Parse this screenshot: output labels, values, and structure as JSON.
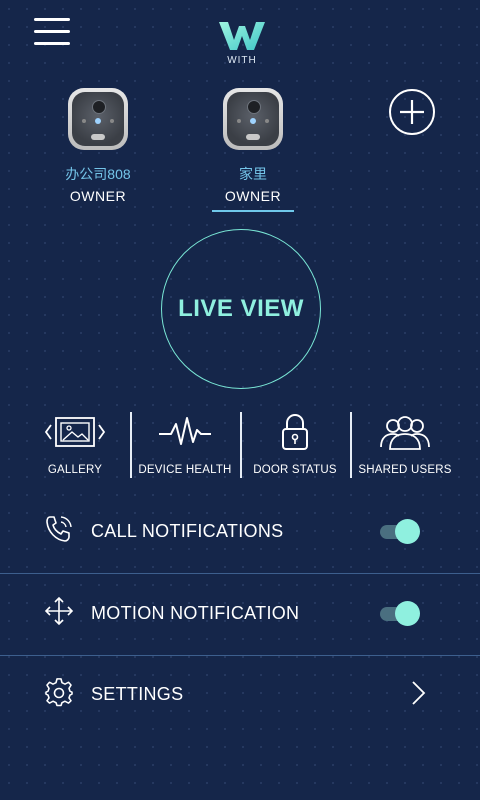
{
  "app": {
    "logo_text": "WITH"
  },
  "devices": [
    {
      "name": "办公司808",
      "role": "OWNER",
      "selected": false
    },
    {
      "name": "家里",
      "role": "OWNER",
      "selected": true
    }
  ],
  "live_view": {
    "label": "LIVE VIEW"
  },
  "features": [
    {
      "label": "GALLERY",
      "icon": "gallery-icon"
    },
    {
      "label": "DEVICE HEALTH",
      "icon": "heartbeat-icon"
    },
    {
      "label": "DOOR STATUS",
      "icon": "lock-icon"
    },
    {
      "label": "SHARED USERS",
      "icon": "users-icon"
    }
  ],
  "settings": {
    "call_notifications": {
      "label": "CALL NOTIFICATIONS",
      "enabled": true,
      "icon": "phone-ringing-icon"
    },
    "motion_notification": {
      "label": "MOTION NOTIFICATION",
      "enabled": true,
      "icon": "move-arrows-icon"
    },
    "settings": {
      "label": "SETTINGS",
      "icon": "gear-icon"
    }
  },
  "colors": {
    "background": "#15264a",
    "accent": "#8ff0df",
    "device_name": "#74c4e8"
  }
}
